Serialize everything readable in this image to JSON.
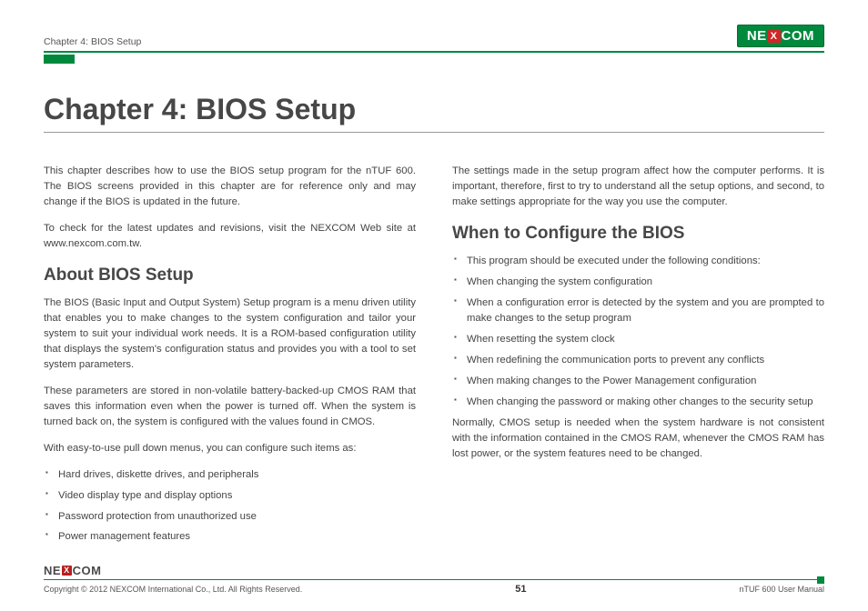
{
  "header": {
    "running_head": "Chapter 4: BIOS Setup",
    "logo_pre": "NE",
    "logo_x": "X",
    "logo_post": "COM"
  },
  "title": "Chapter 4: BIOS Setup",
  "left": {
    "intro1": "This chapter describes how to use the BIOS setup program for the nTUF 600. The BIOS screens provided in this chapter are for reference only and may change if the BIOS is updated in the future.",
    "intro2": "To check for the latest updates and revisions, visit the NEXCOM Web site at www.nexcom.com.tw.",
    "h2": "About BIOS Setup",
    "p1": "The BIOS (Basic Input and Output System) Setup program is a menu driven utility that enables you to make changes to the system configuration and tailor your system to suit your individual work needs. It is a ROM-based configuration utility that displays the system's configuration status and provides you with a tool to set system parameters.",
    "p2": "These parameters are stored in non-volatile battery-backed-up CMOS RAM that saves this information even when the power is turned off. When the system is turned back on, the system is configured with the values found in CMOS.",
    "p3": "With easy-to-use pull down menus, you can configure such items as:",
    "bullets": [
      "Hard drives, diskette drives, and peripherals",
      "Video display type and display options",
      "Password protection from unauthorized use",
      "Power management features"
    ]
  },
  "right": {
    "intro": "The settings made in the setup program affect how the computer performs. It is important, therefore, first to try to understand all the setup options, and second, to make settings appropriate for the way you use the computer.",
    "h2": "When to Configure the BIOS",
    "bullets": [
      "This program should be executed under the following conditions:",
      "When changing the system configuration",
      "When a configuration error is detected by the system and you are prompted to make changes to the setup program",
      "When resetting the system clock",
      "When redefining the communication ports to prevent any conflicts",
      "When making changes to the Power Management configuration",
      "When changing the password or making other changes to the security setup"
    ],
    "closing": "Normally, CMOS setup is needed when the system hardware is not consistent with the information contained in the CMOS RAM, whenever the CMOS RAM has lost power, or the system features need to be changed."
  },
  "footer": {
    "copyright": "Copyright © 2012 NEXCOM International Co., Ltd. All Rights Reserved.",
    "page": "51",
    "doc": "nTUF 600 User Manual",
    "logo_pre": "NE",
    "logo_x": "X",
    "logo_post": "COM"
  }
}
